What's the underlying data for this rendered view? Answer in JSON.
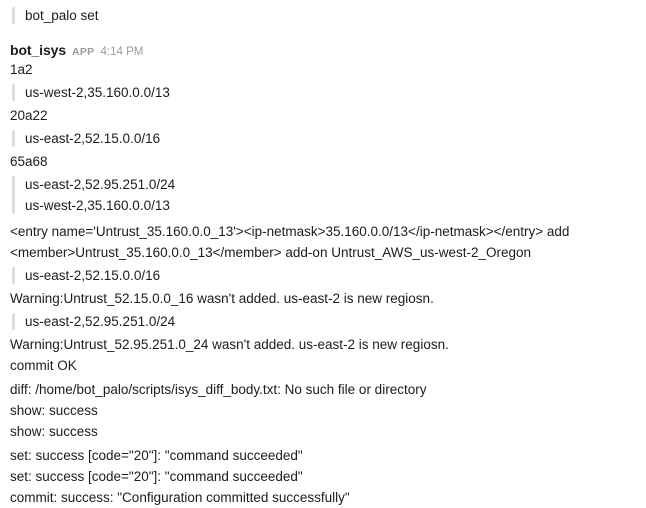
{
  "app": {
    "platform": "slack",
    "background_color": "#ffffff",
    "text_color": "#1d1c1d",
    "meta_color": "#9b9b9b",
    "quote_bar_color": "#dddddd"
  },
  "messages": [
    {
      "id": "msg-prev-fragment",
      "type": "quote",
      "lines": [
        "bot_palo set"
      ]
    },
    {
      "id": "msg-bot-isys",
      "type": "message",
      "header": {
        "author": "bot_isys",
        "badge": "APP",
        "timestamp": "4:14 PM"
      },
      "blocks": [
        {
          "kind": "text",
          "lines": [
            "1a2"
          ]
        },
        {
          "kind": "quote",
          "lines": [
            "us-west-2,35.160.0.0/13"
          ]
        },
        {
          "kind": "text",
          "lines": [
            "20a22"
          ]
        },
        {
          "kind": "quote",
          "lines": [
            "us-east-2,52.15.0.0/16"
          ]
        },
        {
          "kind": "text",
          "lines": [
            "65a68"
          ]
        },
        {
          "kind": "quote",
          "lines": [
            "us-east-2,52.95.251.0/24",
            "us-west-2,35.160.0.0/13"
          ]
        },
        {
          "kind": "text",
          "lines": [
            "<entry name='Untrust_35.160.0.0_13'><ip-netmask>35.160.0.0/13</ip-netmask></entry> add <member>Untrust_35.160.0.0_13</member> add-on Untrust_AWS_us-west-2_Oregon"
          ]
        },
        {
          "kind": "quote",
          "lines": [
            "us-east-2,52.15.0.0/16"
          ]
        },
        {
          "kind": "text",
          "lines": [
            "Warning:Untrust_52.15.0.0_16 wasn't added. us-east-2 is new regiosn."
          ]
        },
        {
          "kind": "quote",
          "lines": [
            "us-east-2,52.95.251.0/24"
          ]
        },
        {
          "kind": "text",
          "lines": [
            "Warning:Untrust_52.95.251.0_24 wasn't added. us-east-2 is new regiosn."
          ]
        },
        {
          "kind": "text",
          "lines": [
            "commit OK"
          ]
        },
        {
          "kind": "text",
          "lines": [
            "diff: /home/bot_palo/scripts/isys_diff_body.txt: No such file or directory"
          ]
        },
        {
          "kind": "text",
          "lines": [
            "show: success"
          ]
        },
        {
          "kind": "text",
          "lines": [
            "show: success"
          ]
        },
        {
          "kind": "text",
          "lines": [
            "set: success [code=\"20\"]: \"command succeeded\""
          ]
        },
        {
          "kind": "text",
          "lines": [
            "set: success [code=\"20\"]: \"command succeeded\""
          ]
        },
        {
          "kind": "text",
          "lines": [
            "commit: success: \"Configuration committed successfully\""
          ]
        }
      ]
    }
  ]
}
